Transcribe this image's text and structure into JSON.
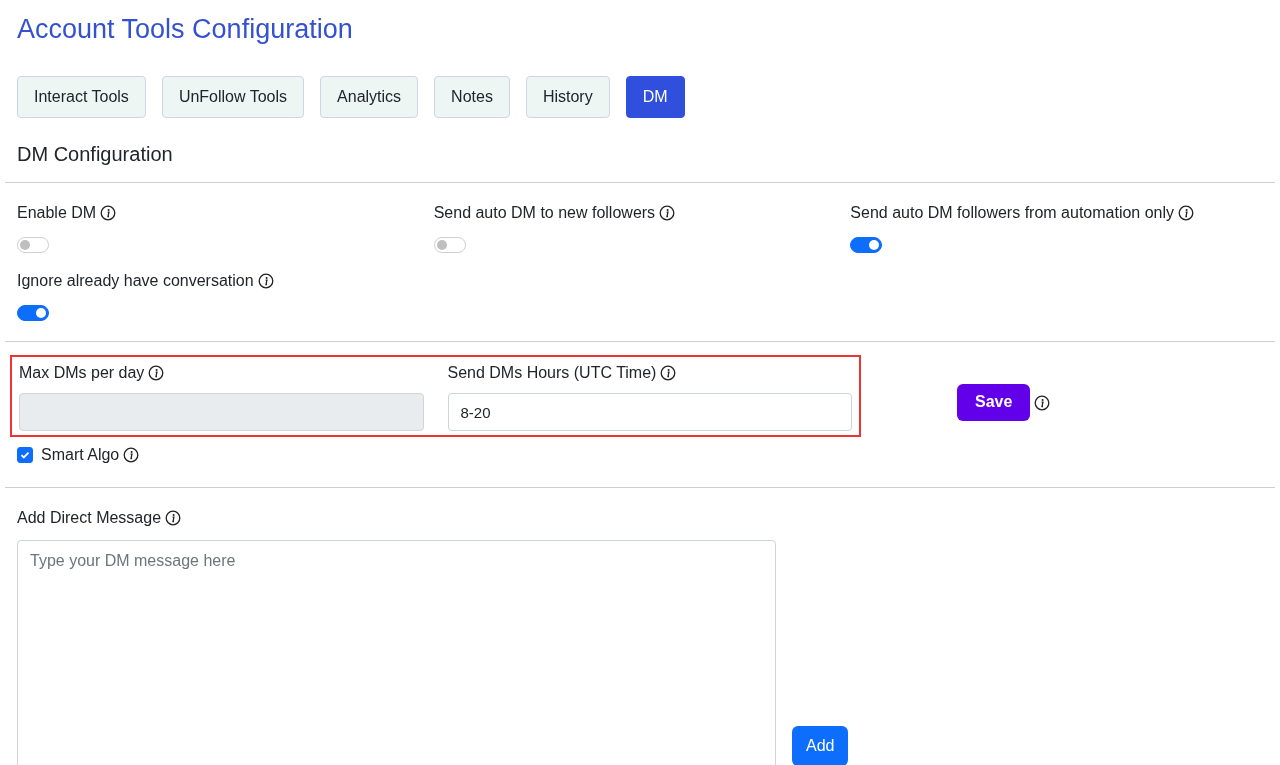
{
  "title": "Account Tools Configuration",
  "tabs": [
    {
      "label": "Interact Tools",
      "selected": false
    },
    {
      "label": "UnFollow Tools",
      "selected": false
    },
    {
      "label": "Analytics",
      "selected": false
    },
    {
      "label": "Notes",
      "selected": false
    },
    {
      "label": "History",
      "selected": false
    },
    {
      "label": "DM",
      "selected": true
    }
  ],
  "section_title": "DM Configuration",
  "toggles": [
    {
      "label": "Enable DM",
      "on": false
    },
    {
      "label": "Send auto DM to new followers",
      "on": false
    },
    {
      "label": "Send auto DM followers from automation only",
      "on": true
    },
    {
      "label": "Ignore already have conversation",
      "on": true
    }
  ],
  "limits": {
    "highlighted": true,
    "fields": [
      {
        "label": "Max DMs per day",
        "disabled": true
      },
      {
        "label": "Send DMs Hours (UTC Time)",
        "value": "8-20",
        "disabled": false
      }
    ]
  },
  "save_button": "Save",
  "smart_algo": {
    "label": "Smart Algo",
    "checked": true
  },
  "message": {
    "label": "Add Direct Message",
    "placeholder": "Type your DM message here"
  },
  "add_button": "Add"
}
